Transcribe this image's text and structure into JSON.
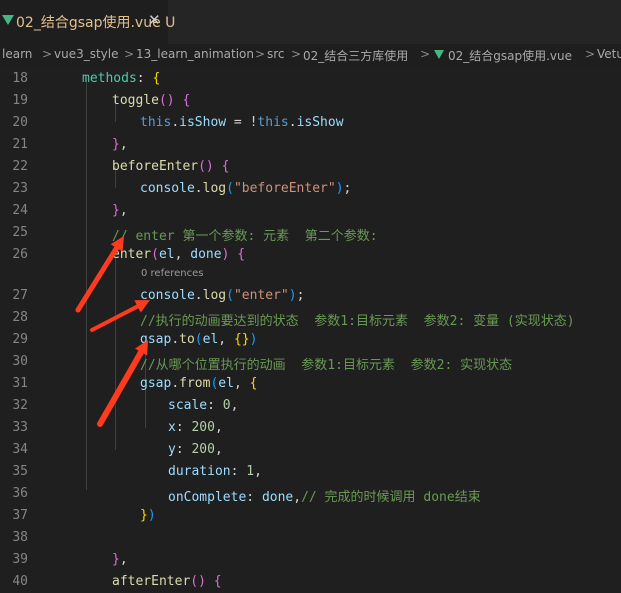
{
  "tab": {
    "filename": "02_结合gsap使用.vue",
    "status": "U",
    "close": "✕"
  },
  "breadcrumb": [
    "learn",
    "vue3_style",
    "13_learn_animation",
    "src",
    "02_结合三方库使用",
    "02_结合gsap使用.vue",
    "Vetu"
  ],
  "breadcrumb_sep": ">",
  "codelens": "0 references",
  "lines": [
    {
      "n": "18",
      "t": [
        [
          "k",
          "methods"
        ],
        [
          "p",
          ": "
        ],
        [
          "b",
          "{"
        ]
      ]
    },
    {
      "n": "19",
      "t": [
        [
          "f",
          "toggle"
        ],
        [
          "bp",
          "()"
        ],
        [
          "p",
          " "
        ],
        [
          "bp",
          "{"
        ]
      ]
    },
    {
      "n": "20",
      "t": [
        [
          "th",
          "this"
        ],
        [
          "p",
          "."
        ],
        [
          "v",
          "isShow"
        ],
        [
          "p",
          " = !"
        ],
        [
          "th",
          "this"
        ],
        [
          "p",
          "."
        ],
        [
          "v",
          "isShow"
        ]
      ]
    },
    {
      "n": "21",
      "t": [
        [
          "bp",
          "}"
        ],
        [
          "p",
          ","
        ]
      ]
    },
    {
      "n": "22",
      "t": [
        [
          "f",
          "beforeEnter"
        ],
        [
          "bp",
          "()"
        ],
        [
          "p",
          " "
        ],
        [
          "bp",
          "{"
        ]
      ]
    },
    {
      "n": "23",
      "t": [
        [
          "v",
          "console"
        ],
        [
          "p",
          "."
        ],
        [
          "f",
          "log"
        ],
        [
          "bb",
          "("
        ],
        [
          "s",
          "\"beforeEnter\""
        ],
        [
          "bb",
          ")"
        ],
        [
          "p",
          ";"
        ]
      ]
    },
    {
      "n": "24",
      "t": [
        [
          "bp",
          "}"
        ],
        [
          "p",
          ","
        ]
      ]
    },
    {
      "n": "25",
      "t": [
        [
          "c",
          "// enter 第一个参数: 元素  第二个参数:"
        ]
      ]
    },
    {
      "n": "26",
      "t": [
        [
          "f",
          "enter"
        ],
        [
          "bp",
          "("
        ],
        [
          "v",
          "el"
        ],
        [
          "p",
          ", "
        ],
        [
          "v",
          "done"
        ],
        [
          "bp",
          ")"
        ],
        [
          "p",
          " "
        ],
        [
          "bp",
          "{"
        ]
      ]
    },
    {
      "n": "27",
      "t": [
        [
          "v",
          "console"
        ],
        [
          "p",
          "."
        ],
        [
          "f",
          "log"
        ],
        [
          "bb",
          "("
        ],
        [
          "s",
          "\"enter\""
        ],
        [
          "bb",
          ")"
        ],
        [
          "p",
          ";"
        ]
      ]
    },
    {
      "n": "28",
      "t": [
        [
          "c",
          "//执行的动画要达到的状态  参数1:目标元素  参数2: 变量 (实现状态)"
        ]
      ]
    },
    {
      "n": "29",
      "t": [
        [
          "v",
          "gsap"
        ],
        [
          "p",
          "."
        ],
        [
          "f",
          "to"
        ],
        [
          "bb",
          "("
        ],
        [
          "v",
          "el"
        ],
        [
          "p",
          ", "
        ],
        [
          "b",
          "{}"
        ],
        [
          "bb",
          ")"
        ]
      ]
    },
    {
      "n": "30",
      "t": [
        [
          "c",
          "//从哪个位置执行的动画  参数1:目标元素  参数2: 实现状态"
        ]
      ]
    },
    {
      "n": "31",
      "t": [
        [
          "v",
          "gsap"
        ],
        [
          "p",
          "."
        ],
        [
          "f",
          "from"
        ],
        [
          "bb",
          "("
        ],
        [
          "v",
          "el"
        ],
        [
          "p",
          ", "
        ],
        [
          "b",
          "{"
        ]
      ]
    },
    {
      "n": "32",
      "t": [
        [
          "v",
          "scale"
        ],
        [
          "p",
          ": "
        ],
        [
          "n",
          "0"
        ],
        [
          "p",
          ","
        ]
      ]
    },
    {
      "n": "33",
      "t": [
        [
          "v",
          "x"
        ],
        [
          "p",
          ": "
        ],
        [
          "n",
          "200"
        ],
        [
          "p",
          ","
        ]
      ]
    },
    {
      "n": "34",
      "t": [
        [
          "v",
          "y"
        ],
        [
          "p",
          ": "
        ],
        [
          "n",
          "200"
        ],
        [
          "p",
          ","
        ]
      ]
    },
    {
      "n": "35",
      "t": [
        [
          "v",
          "duration"
        ],
        [
          "p",
          ": "
        ],
        [
          "n",
          "1"
        ],
        [
          "p",
          ","
        ]
      ]
    },
    {
      "n": "36",
      "t": [
        [
          "v",
          "onComplete"
        ],
        [
          "p",
          ": "
        ],
        [
          "v",
          "done"
        ],
        [
          "p",
          ","
        ],
        [
          "c",
          "// 完成的时候调用 done结束"
        ]
      ]
    },
    {
      "n": "37",
      "t": [
        [
          "b",
          "}"
        ],
        [
          "bb",
          ")"
        ]
      ]
    },
    {
      "n": "38",
      "t": []
    },
    {
      "n": "39",
      "t": [
        [
          "bp",
          "}"
        ],
        [
          "p",
          ","
        ]
      ]
    },
    {
      "n": "40",
      "t": [
        [
          "f",
          "afterEnter"
        ],
        [
          "bp",
          "()"
        ],
        [
          "p",
          " "
        ],
        [
          "bp",
          "{"
        ]
      ]
    }
  ],
  "colors": {
    "arrow": "#ff3b1f",
    "accent_vue": "#42b883",
    "modified": "#e2c08d"
  }
}
